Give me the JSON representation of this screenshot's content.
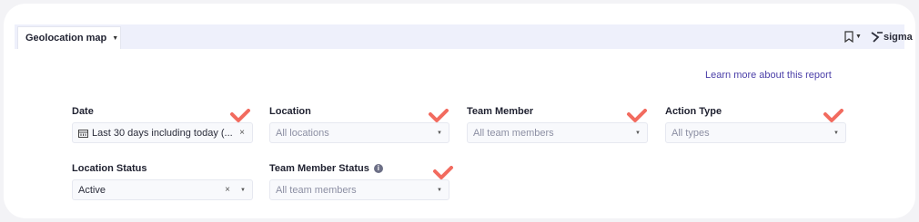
{
  "header": {
    "tab_label": "Geolocation map",
    "brand_name": "sigma"
  },
  "links": {
    "learn_more": "Learn more about this report"
  },
  "filters": [
    {
      "label": "Date",
      "value": "Last 30 days including today (...",
      "placeholder": "",
      "has_clear": true,
      "icon": "calendar-icon"
    },
    {
      "label": "Location",
      "value": "",
      "placeholder": "All locations",
      "has_clear": false
    },
    {
      "label": "Team Member",
      "value": "",
      "placeholder": "All team members",
      "has_clear": false
    },
    {
      "label": "Action Type",
      "value": "",
      "placeholder": "All types",
      "has_clear": false
    },
    {
      "label": "Location Status",
      "value": "Active",
      "placeholder": "",
      "has_clear": true
    },
    {
      "label": "Team Member Status",
      "value": "",
      "placeholder": "All team members",
      "has_clear": false,
      "info_icon": true
    }
  ],
  "symbols": {
    "clear": "×",
    "caret": "▼",
    "info": "i"
  },
  "colors": {
    "accent_link": "#4b3fa8",
    "check_mark": "#f26b5f",
    "toolbar_bg": "#eef0fb"
  }
}
